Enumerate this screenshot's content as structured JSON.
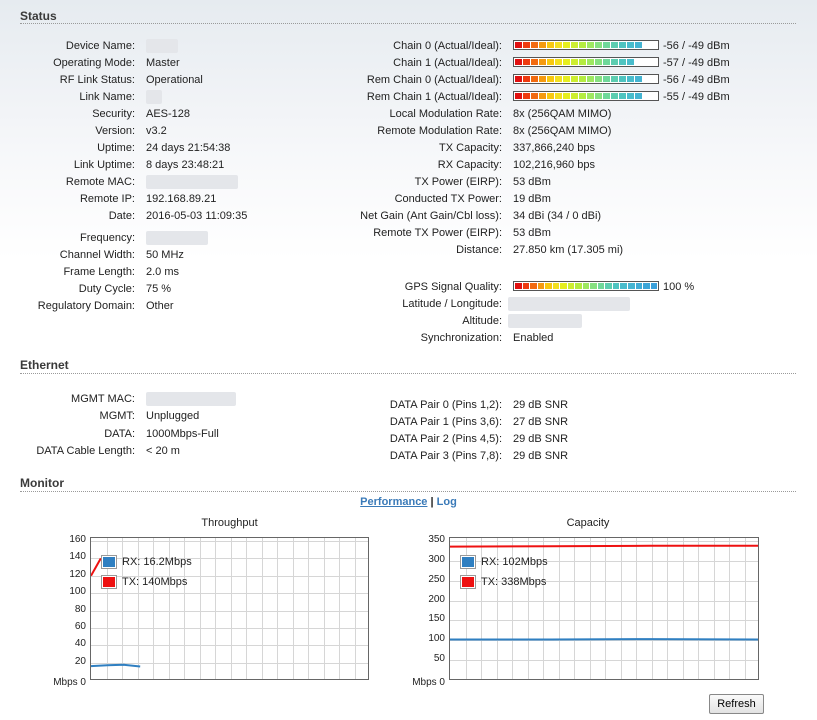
{
  "sections": {
    "status": "Status",
    "ethernet": "Ethernet",
    "monitor": "Monitor"
  },
  "status_left": [
    {
      "label": "Device Name:",
      "value": "",
      "redacted": true
    },
    {
      "label": "Operating Mode:",
      "value": "Master"
    },
    {
      "label": "RF Link Status:",
      "value": "Operational"
    },
    {
      "label": "Link Name:",
      "value": "",
      "redacted": true
    },
    {
      "label": "Security:",
      "value": "AES-128"
    },
    {
      "label": "Version:",
      "value": "v3.2"
    },
    {
      "label": "Uptime:",
      "value": "24 days 21:54:38"
    },
    {
      "label": "Link Uptime:",
      "value": "8 days 23:48:21"
    },
    {
      "label": "Remote MAC:",
      "value": "",
      "redacted": true
    },
    {
      "label": "Remote IP:",
      "value": "192.168.89.21"
    },
    {
      "label": "Date:",
      "value": "2016-05-03 11:09:35"
    },
    {
      "label": "Frequency:",
      "value": "",
      "redacted": true
    },
    {
      "label": "Channel Width:",
      "value": "50 MHz"
    },
    {
      "label": "Frame Length:",
      "value": "2.0 ms"
    },
    {
      "label": "Duty Cycle:",
      "value": "75 %"
    },
    {
      "label": "Regulatory Domain:",
      "value": "Other"
    }
  ],
  "signal_chains": [
    {
      "label": "Chain 0 (Actual/Ideal):",
      "value": "-56 / -49 dBm",
      "level": 0.83
    },
    {
      "label": "Chain 1 (Actual/Ideal):",
      "value": "-57 / -49 dBm",
      "level": 0.81
    },
    {
      "label": "Rem Chain 0 (Actual/Ideal):",
      "value": "-56 / -49 dBm",
      "level": 0.83
    },
    {
      "label": "Rem Chain 1 (Actual/Ideal):",
      "value": "-55 / -49 dBm",
      "level": 0.83
    }
  ],
  "status_right": [
    {
      "label": "Local Modulation Rate:",
      "value": "8x (256QAM MIMO)"
    },
    {
      "label": "Remote Modulation Rate:",
      "value": "8x (256QAM MIMO)"
    },
    {
      "label": "TX Capacity:",
      "value": "337,866,240 bps"
    },
    {
      "label": "RX Capacity:",
      "value": "102,216,960 bps"
    },
    {
      "label": "TX Power (EIRP):",
      "value": "53 dBm"
    },
    {
      "label": "Conducted TX Power:",
      "value": "19 dBm"
    },
    {
      "label": "Net Gain (Ant Gain/Cbl loss):",
      "value": "34 dBi (34 / 0 dBi)"
    },
    {
      "label": "Remote TX Power (EIRP):",
      "value": "53 dBm"
    },
    {
      "label": "Distance:",
      "value": "27.850 km (17.305 mi)"
    }
  ],
  "gps": {
    "quality_label": "GPS Signal Quality:",
    "quality_value": "100 %",
    "quality_level": 1.0,
    "latlon_label": "Latitude / Longitude:",
    "altitude_label": "Altitude:",
    "sync_label": "Synchronization:",
    "sync_value": "Enabled"
  },
  "ethernet_left": [
    {
      "label": "MGMT MAC:",
      "value": "",
      "redacted": true
    },
    {
      "label": "MGMT:",
      "value": "Unplugged"
    },
    {
      "label": "DATA:",
      "value": "1000Mbps-Full"
    },
    {
      "label": "DATA Cable Length:",
      "value": "< 20 m"
    }
  ],
  "ethernet_right": [
    {
      "label": "DATA Pair 0 (Pins 1,2):",
      "value": "29 dB SNR"
    },
    {
      "label": "DATA Pair 1 (Pins 3,6):",
      "value": "27 dB SNR"
    },
    {
      "label": "DATA Pair 2 (Pins 4,5):",
      "value": "29 dB SNR"
    },
    {
      "label": "DATA Pair 3 (Pins 7,8):",
      "value": "29 dB SNR"
    }
  ],
  "monitor_tabs": {
    "performance": "Performance",
    "separator": "|",
    "log": "Log"
  },
  "refresh_label": "Refresh",
  "colors": {
    "rx": "#2f7fc1",
    "tx": "#ee1111"
  },
  "chart_data": [
    {
      "type": "line",
      "title": "Throughput",
      "ylabel": "Mbps",
      "ylim": [
        0,
        160
      ],
      "yticks": [
        0,
        20,
        40,
        60,
        80,
        100,
        120,
        140,
        160
      ],
      "grid": true,
      "legend_placement": "top-left",
      "series": [
        {
          "name": "RX: 16.2Mbps",
          "key": "rx",
          "x": [
            0,
            1,
            2,
            3
          ],
          "values": [
            16,
            17,
            17.5,
            15.5
          ]
        },
        {
          "name": "TX: 140Mbps",
          "key": "tx",
          "x": [
            0,
            0.6
          ],
          "values": [
            120,
            140
          ]
        }
      ]
    },
    {
      "type": "line",
      "title": "Capacity",
      "ylabel": "Mbps",
      "ylim": [
        0,
        350
      ],
      "yticks": [
        0,
        50,
        100,
        150,
        200,
        250,
        300,
        350
      ],
      "grid": true,
      "legend_placement": "top-left",
      "series": [
        {
          "name": "RX: 102Mbps",
          "key": "rx",
          "x": [
            0,
            10,
            20,
            31
          ],
          "values": [
            102,
            102,
            103,
            102
          ]
        },
        {
          "name": "TX: 338Mbps",
          "key": "tx",
          "x": [
            0,
            10,
            20,
            31
          ],
          "values": [
            336,
            337,
            338,
            338
          ]
        }
      ]
    }
  ]
}
